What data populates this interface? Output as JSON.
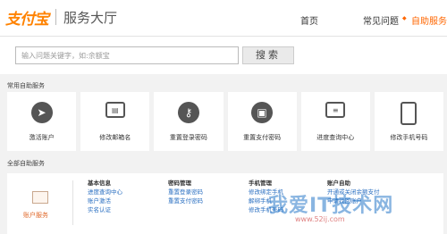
{
  "header": {
    "brand": "支付宝",
    "title": "服务大厅",
    "nav": [
      "首页",
      "常见问题",
      "自助服务"
    ]
  },
  "search": {
    "placeholder": "输入问题关键字，如:余额宝",
    "button": "搜索"
  },
  "common_services": {
    "heading": "常用自助服务",
    "cards": [
      {
        "label": "激活账户",
        "icon": "cursor-icon"
      },
      {
        "label": "修改邮箱名",
        "icon": "id-card-icon"
      },
      {
        "label": "重置登录密码",
        "icon": "key-icon"
      },
      {
        "label": "重置支付密码",
        "icon": "lock-icon"
      },
      {
        "label": "进度查询中心",
        "icon": "documents-icon"
      },
      {
        "label": "修改手机号码",
        "icon": "phone-icon"
      }
    ]
  },
  "all_services": {
    "heading": "全部自助服务",
    "category": "账户服务",
    "columns": [
      {
        "title": "基本信息",
        "links": [
          "进度查询中心",
          "账户激活",
          "实名认证"
        ]
      },
      {
        "title": "密码管理",
        "links": [
          "重置登录密码",
          "重置支付密码"
        ]
      },
      {
        "title": "手机管理",
        "links": [
          "修改绑定手机",
          "解绑手机",
          "修改手机号码"
        ]
      },
      {
        "title": "账户自助",
        "links": [
          "开通或关闭余额支付",
          "申请找回账户"
        ]
      }
    ]
  },
  "watermark": {
    "main": "我爱IT技术网",
    "sub": "www.52ij.com"
  },
  "colors": {
    "brand": "#ff8200",
    "link": "#2a6fc1",
    "accent": "#e06a2c"
  }
}
